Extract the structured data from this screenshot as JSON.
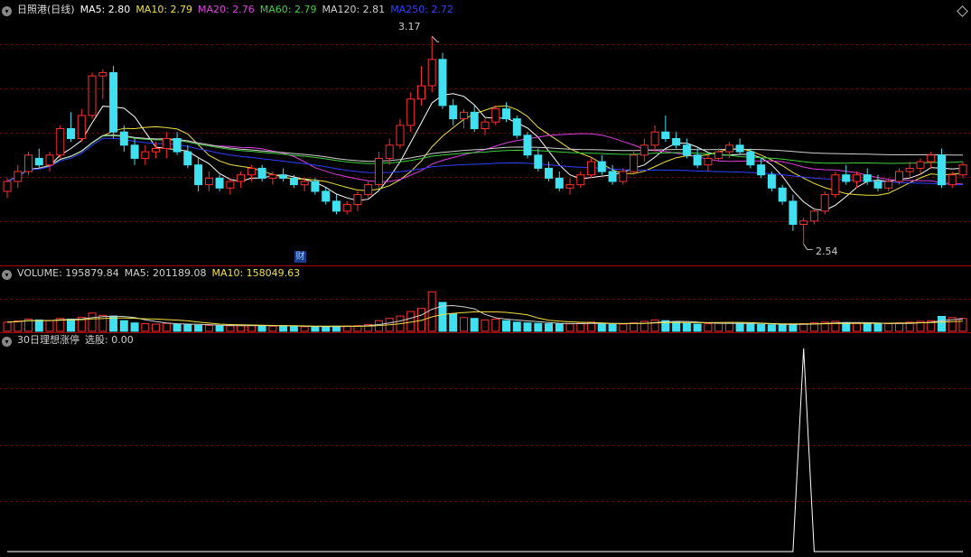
{
  "panel1": {
    "stock_label": "日照港(日线)",
    "indicators": [
      {
        "label": "MA5: 2.80",
        "color": "#ffffff"
      },
      {
        "label": "MA10: 2.79",
        "color": "#f0e040"
      },
      {
        "label": "MA20: 2.76",
        "color": "#e040e0"
      },
      {
        "label": "MA60: 2.79",
        "color": "#40d040"
      },
      {
        "label": "MA120: 2.81",
        "color": "#d0d0d0"
      },
      {
        "label": "MA250: 2.72",
        "color": "#3040ff"
      }
    ],
    "high_label": "3.17",
    "low_label": "2.54",
    "badge": "财"
  },
  "panel2": {
    "indicators": [
      {
        "label": "VOLUME: 195879.84",
        "color": "#d0d0d0"
      },
      {
        "label": "MA5: 201189.08",
        "color": "#d0d0d0"
      },
      {
        "label": "MA10: 158049.63",
        "color": "#f0e040"
      }
    ]
  },
  "panel3": {
    "indicators": [
      {
        "label": "30日理想涨停",
        "color": "#d0d0d0"
      },
      {
        "label": "选股: 0.00",
        "color": "#d0d0d0"
      }
    ]
  },
  "colors": {
    "up": "#ff3030",
    "down": "#40e0f0",
    "grid": "#8b0000"
  },
  "chart_data": [
    {
      "type": "candlestick",
      "title": "日照港(日线)",
      "ylim": [
        2.5,
        3.22
      ],
      "high": 3.17,
      "low": 2.54,
      "candles": [
        [
          2.7,
          2.74,
          2.68,
          2.73
        ],
        [
          2.73,
          2.78,
          2.71,
          2.76
        ],
        [
          2.76,
          2.82,
          2.75,
          2.81
        ],
        [
          2.8,
          2.83,
          2.77,
          2.78
        ],
        [
          2.78,
          2.82,
          2.76,
          2.81
        ],
        [
          2.81,
          2.9,
          2.8,
          2.89
        ],
        [
          2.89,
          2.94,
          2.85,
          2.86
        ],
        [
          2.86,
          2.95,
          2.85,
          2.93
        ],
        [
          2.93,
          3.06,
          2.92,
          3.05
        ],
        [
          3.05,
          3.07,
          2.98,
          3.06
        ],
        [
          3.06,
          3.08,
          2.86,
          2.88
        ],
        [
          2.88,
          2.9,
          2.82,
          2.84
        ],
        [
          2.84,
          2.86,
          2.78,
          2.8
        ],
        [
          2.8,
          2.84,
          2.78,
          2.82
        ],
        [
          2.82,
          2.85,
          2.8,
          2.83
        ],
        [
          2.83,
          2.88,
          2.8,
          2.86
        ],
        [
          2.86,
          2.88,
          2.81,
          2.82
        ],
        [
          2.82,
          2.84,
          2.77,
          2.78
        ],
        [
          2.78,
          2.8,
          2.7,
          2.72
        ],
        [
          2.72,
          2.76,
          2.7,
          2.74
        ],
        [
          2.74,
          2.75,
          2.7,
          2.71
        ],
        [
          2.71,
          2.74,
          2.69,
          2.73
        ],
        [
          2.73,
          2.76,
          2.71,
          2.75
        ],
        [
          2.75,
          2.78,
          2.73,
          2.77
        ],
        [
          2.77,
          2.78,
          2.73,
          2.74
        ],
        [
          2.74,
          2.76,
          2.72,
          2.75
        ],
        [
          2.75,
          2.77,
          2.73,
          2.74
        ],
        [
          2.74,
          2.75,
          2.71,
          2.72
        ],
        [
          2.72,
          2.74,
          2.7,
          2.73
        ],
        [
          2.73,
          2.74,
          2.69,
          2.7
        ],
        [
          2.7,
          2.71,
          2.66,
          2.67
        ],
        [
          2.67,
          2.69,
          2.63,
          2.64
        ],
        [
          2.64,
          2.67,
          2.63,
          2.66
        ],
        [
          2.66,
          2.7,
          2.64,
          2.69
        ],
        [
          2.69,
          2.73,
          2.68,
          2.72
        ],
        [
          2.72,
          2.82,
          2.71,
          2.8
        ],
        [
          2.8,
          2.86,
          2.78,
          2.84
        ],
        [
          2.84,
          2.92,
          2.83,
          2.9
        ],
        [
          2.9,
          3.0,
          2.88,
          2.98
        ],
        [
          2.98,
          3.08,
          2.96,
          3.02
        ],
        [
          3.02,
          3.17,
          3.0,
          3.1
        ],
        [
          3.1,
          3.12,
          2.95,
          2.96
        ],
        [
          2.96,
          2.98,
          2.9,
          2.92
        ],
        [
          2.92,
          2.95,
          2.89,
          2.94
        ],
        [
          2.94,
          2.96,
          2.88,
          2.89
        ],
        [
          2.89,
          2.92,
          2.87,
          2.91
        ],
        [
          2.91,
          2.96,
          2.9,
          2.95
        ],
        [
          2.95,
          2.97,
          2.91,
          2.92
        ],
        [
          2.92,
          2.93,
          2.86,
          2.87
        ],
        [
          2.87,
          2.88,
          2.8,
          2.81
        ],
        [
          2.81,
          2.83,
          2.76,
          2.77
        ],
        [
          2.77,
          2.79,
          2.73,
          2.74
        ],
        [
          2.74,
          2.76,
          2.7,
          2.71
        ],
        [
          2.71,
          2.74,
          2.69,
          2.72
        ],
        [
          2.72,
          2.76,
          2.71,
          2.75
        ],
        [
          2.75,
          2.8,
          2.74,
          2.79
        ],
        [
          2.79,
          2.81,
          2.75,
          2.76
        ],
        [
          2.76,
          2.78,
          2.72,
          2.73
        ],
        [
          2.73,
          2.77,
          2.72,
          2.76
        ],
        [
          2.76,
          2.82,
          2.75,
          2.81
        ],
        [
          2.81,
          2.86,
          2.79,
          2.84
        ],
        [
          2.84,
          2.9,
          2.82,
          2.88
        ],
        [
          2.88,
          2.93,
          2.85,
          2.86
        ],
        [
          2.86,
          2.88,
          2.83,
          2.84
        ],
        [
          2.84,
          2.86,
          2.8,
          2.81
        ],
        [
          2.81,
          2.83,
          2.77,
          2.78
        ],
        [
          2.78,
          2.81,
          2.76,
          2.8
        ],
        [
          2.8,
          2.83,
          2.79,
          2.82
        ],
        [
          2.82,
          2.85,
          2.8,
          2.84
        ],
        [
          2.84,
          2.86,
          2.81,
          2.82
        ],
        [
          2.82,
          2.83,
          2.77,
          2.78
        ],
        [
          2.78,
          2.8,
          2.74,
          2.75
        ],
        [
          2.75,
          2.76,
          2.7,
          2.71
        ],
        [
          2.71,
          2.72,
          2.66,
          2.67
        ],
        [
          2.67,
          2.69,
          2.58,
          2.6
        ],
        [
          2.6,
          2.62,
          2.54,
          2.61
        ],
        [
          2.61,
          2.65,
          2.6,
          2.64
        ],
        [
          2.64,
          2.7,
          2.63,
          2.69
        ],
        [
          2.69,
          2.76,
          2.68,
          2.75
        ],
        [
          2.75,
          2.78,
          2.72,
          2.73
        ],
        [
          2.73,
          2.76,
          2.71,
          2.75
        ],
        [
          2.75,
          2.77,
          2.72,
          2.73
        ],
        [
          2.73,
          2.75,
          2.7,
          2.71
        ],
        [
          2.71,
          2.74,
          2.7,
          2.73
        ],
        [
          2.73,
          2.77,
          2.72,
          2.76
        ],
        [
          2.76,
          2.79,
          2.74,
          2.77
        ],
        [
          2.77,
          2.8,
          2.75,
          2.79
        ],
        [
          2.79,
          2.82,
          2.77,
          2.81
        ],
        [
          2.81,
          2.83,
          2.71,
          2.72
        ],
        [
          2.72,
          2.76,
          2.71,
          2.75
        ],
        [
          2.75,
          2.79,
          2.74,
          2.78
        ]
      ],
      "series": [
        {
          "name": "MA5",
          "color": "#ffffff",
          "last": 2.8
        },
        {
          "name": "MA10",
          "color": "#f0e040",
          "last": 2.79
        },
        {
          "name": "MA20",
          "color": "#e040e0",
          "last": 2.76
        },
        {
          "name": "MA60",
          "color": "#40d040",
          "last": 2.79
        },
        {
          "name": "MA120",
          "color": "#d0d0d0",
          "last": 2.81
        },
        {
          "name": "MA250",
          "color": "#3040ff",
          "last": 2.72
        }
      ]
    },
    {
      "type": "bar",
      "title": "VOLUME",
      "ylim": [
        0,
        700000
      ],
      "values": [
        120000,
        135000,
        160000,
        150000,
        140000,
        170000,
        160000,
        185000,
        240000,
        210000,
        200000,
        140000,
        110000,
        100000,
        95000,
        105000,
        90000,
        85000,
        80000,
        78000,
        70000,
        72000,
        75000,
        80000,
        70000,
        68000,
        72000,
        65000,
        60000,
        58000,
        62000,
        68000,
        70000,
        75000,
        90000,
        140000,
        170000,
        200000,
        260000,
        300000,
        520000,
        380000,
        230000,
        180000,
        170000,
        150000,
        160000,
        140000,
        120000,
        110000,
        105000,
        100000,
        95000,
        98000,
        105000,
        120000,
        100000,
        90000,
        95000,
        110000,
        130000,
        150000,
        140000,
        120000,
        105000,
        95000,
        100000,
        110000,
        115000,
        105000,
        95000,
        90000,
        85000,
        88000,
        92000,
        100000,
        110000,
        120000,
        130000,
        115000,
        105000,
        98000,
        95000,
        100000,
        110000,
        120000,
        130000,
        140000,
        195879,
        180000,
        170000
      ],
      "series": [
        {
          "name": "MA5",
          "color": "#d0d0d0",
          "last": 201189.08
        },
        {
          "name": "MA10",
          "color": "#f0e040",
          "last": 158049.63
        }
      ]
    },
    {
      "type": "line",
      "title": "30日理想涨停",
      "ylim": [
        0,
        1
      ],
      "series": [
        {
          "name": "选股",
          "color": "#ffffff",
          "spike_index": 75,
          "last": 0.0
        }
      ]
    }
  ]
}
